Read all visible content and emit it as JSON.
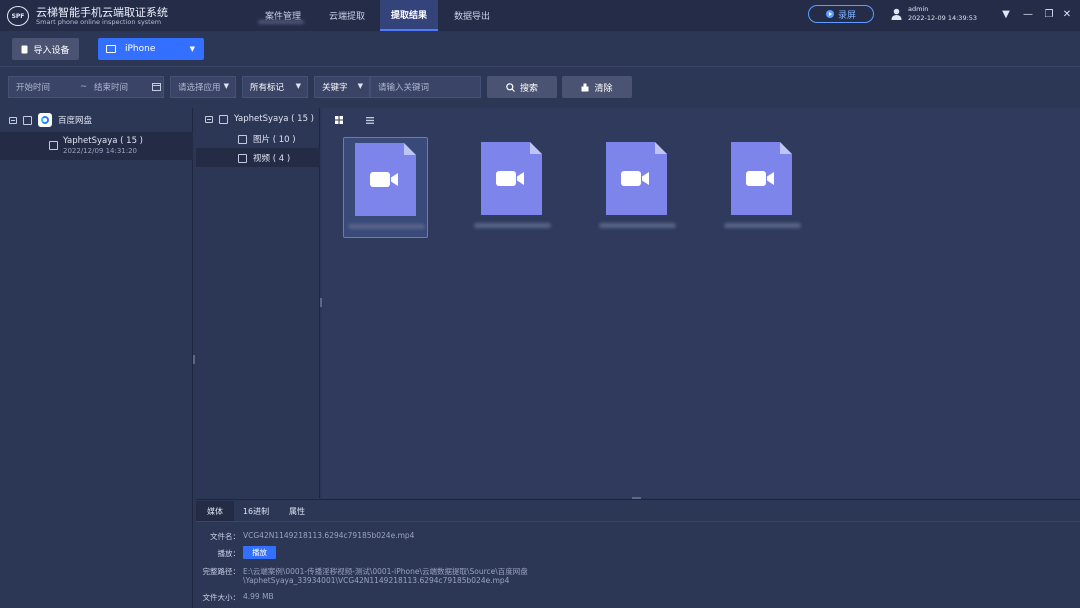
{
  "app": {
    "logo_text": "SPF",
    "title": "云梯智能手机云端取证系统",
    "subtitle": "Smart phone online inspection system"
  },
  "nav": {
    "tabs": [
      {
        "label": "案件管理",
        "active": false
      },
      {
        "label": "云端提取",
        "active": false
      },
      {
        "label": "提取结果",
        "active": true
      },
      {
        "label": "数据导出",
        "active": false
      }
    ]
  },
  "header": {
    "record_label": "录屏",
    "user_name": "admin",
    "user_time": "2022-12-09 14:39:53",
    "menu_icon": "caret-down-icon",
    "minimize_icon": "minimize-icon",
    "restore_icon": "restore-icon",
    "close_icon": "close-icon"
  },
  "toolbar": {
    "import_label": "导入设备",
    "device_selected": "iPhone"
  },
  "filters": {
    "start_time_placeholder": "开始时间",
    "range_separator": "~",
    "end_time_placeholder": "结束时间",
    "app_select": "请选择应用",
    "mark_select": "所有标记",
    "keyword_select": "关键字",
    "keyword_placeholder": "请输入关键词",
    "search_label": "搜索",
    "clear_label": "清除"
  },
  "left_tree": {
    "root_label": "百度网盘",
    "account_label": "YaphetSyaya ( 15 )",
    "account_time": "2022/12/09 14:31:20"
  },
  "mid_tree": {
    "root_label": "YaphetSyaya ( 15 )",
    "items": [
      {
        "label": "图片 ( 10 )",
        "selected": false
      },
      {
        "label": "视频 ( 4 )",
        "selected": true
      }
    ]
  },
  "files": {
    "type_icon": "video-file-icon",
    "count": 4,
    "selected_index": 0
  },
  "details": {
    "tabs": [
      {
        "label": "媒体",
        "active": true
      },
      {
        "label": "16进制",
        "active": false
      },
      {
        "label": "属性",
        "active": false
      }
    ],
    "filename_label": "文件名：",
    "filename_value": "VCG42N1149218113.6294c79185b024e.mp4",
    "play_label": "播放：",
    "play_button": "播放",
    "path_label": "完整路径：",
    "path_line1": "E:\\云端案例\\0001-传播淫秽视频-测试\\0001-iPhone\\云端数据提取\\Source\\百度网盘",
    "path_line2": "\\YaphetSyaya_33934001\\VCG42N1149218113.6294c79185b024e.mp4",
    "size_label": "文件大小：",
    "size_value": "4.99 MB"
  },
  "colors": {
    "accent": "#3470ff",
    "background": "#2c3655",
    "titlebar": "#242c48",
    "file_icon": "#7d85eb"
  }
}
